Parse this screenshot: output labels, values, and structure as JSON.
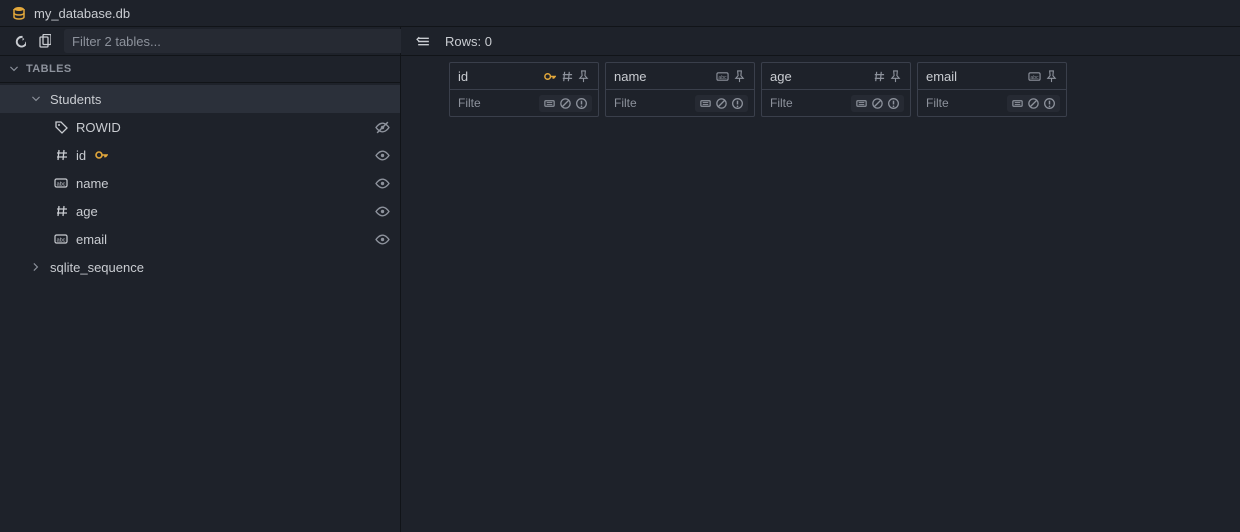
{
  "title": "my_database.db",
  "sidebar": {
    "filter_placeholder": "Filter 2 tables...",
    "section_label": "TABLES",
    "tables": [
      {
        "name": "Students",
        "expanded": true,
        "selected": true,
        "columns": [
          {
            "name": "ROWID",
            "icon": "tag",
            "pk": false,
            "hidden": true
          },
          {
            "name": "id",
            "icon": "hash",
            "pk": true,
            "hidden": false
          },
          {
            "name": "name",
            "icon": "abc",
            "pk": false,
            "hidden": false
          },
          {
            "name": "age",
            "icon": "hash",
            "pk": false,
            "hidden": false
          },
          {
            "name": "email",
            "icon": "abc",
            "pk": false,
            "hidden": false
          }
        ]
      },
      {
        "name": "sqlite_sequence",
        "expanded": false
      }
    ]
  },
  "grid": {
    "rows_label": "Rows: 0",
    "filter_placeholder": "Filte",
    "columns": [
      {
        "name": "id",
        "type": "hash",
        "pk": true
      },
      {
        "name": "name",
        "type": "abc",
        "pk": false
      },
      {
        "name": "age",
        "type": "hash",
        "pk": false
      },
      {
        "name": "email",
        "type": "abc",
        "pk": false
      }
    ]
  }
}
